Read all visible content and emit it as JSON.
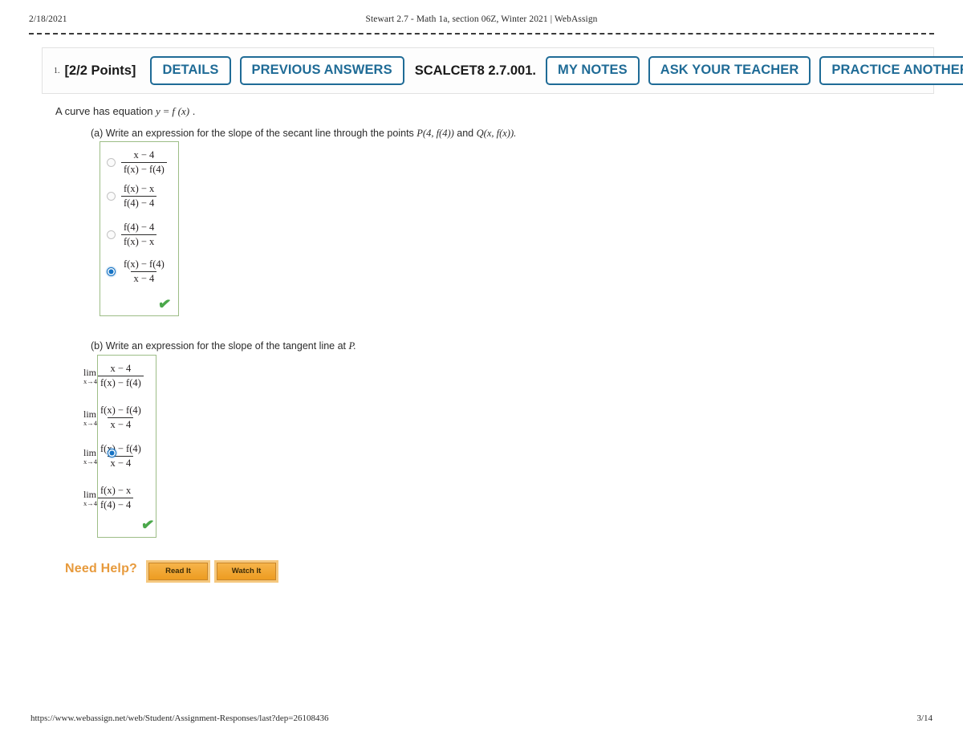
{
  "print_header": {
    "date": "2/18/2021",
    "title": "Stewart 2.7 - Math 1a, section 06Z, Winter 2021 | WebAssign"
  },
  "question_bar": {
    "number": "1.",
    "points": "[2/2 Points]",
    "details_label": "DETAILS",
    "previous_answers_label": "PREVIOUS ANSWERS",
    "code": "SCALCET8 2.7.001.",
    "my_notes_label": "MY NOTES",
    "ask_teacher_label": "ASK YOUR TEACHER",
    "practice_another_label": "PRACTICE ANOTHER",
    "button_color": "#1f6b96"
  },
  "question": {
    "stem_prefix": "A curve has equation",
    "stem_y": "y",
    "stem_eq": "=",
    "stem_f": "f",
    "stem_x": "(x)",
    "stem_period": ".",
    "part_a": {
      "label": "(a)",
      "text": "Write an expression for the slope of the secant line through the points",
      "point_p": "P(4, f(4))",
      "conj": "and",
      "point_q": "Q(x, f(x)).",
      "selected_index": 3,
      "correct": true,
      "check_glyph": "✔",
      "options": [
        {
          "numerator": "x − 4",
          "denominator": "f(x) − f(4)"
        },
        {
          "numerator": "f(x) − x",
          "denominator": "f(4) − 4"
        },
        {
          "numerator": "f(4) − 4",
          "denominator": "f(x) − x"
        },
        {
          "numerator": "f(x) − f(4)",
          "denominator": "x − 4"
        }
      ]
    },
    "part_b": {
      "label": "(b)",
      "text": "Write an expression for the slope of the tangent line at",
      "point": "P.",
      "selected_index": 2,
      "correct": true,
      "check_glyph": "✔",
      "lim_op": "lim",
      "lim_sub": "x→4",
      "options": [
        {
          "numerator": "x − 4",
          "denominator": "f(x) − f(4)"
        },
        {
          "numerator": "f(x) − f(4)",
          "denominator": "x − 4"
        },
        {
          "numerator": "f(x) − f(4)",
          "denominator": "x − 4"
        },
        {
          "numerator": "f(x) − x",
          "denominator": "f(4) − 4"
        }
      ]
    }
  },
  "need_help": {
    "label": "Need Help?",
    "read_it_label": "Read It",
    "watch_it_label": "Watch It",
    "accent_color": "#e79a3c"
  },
  "print_footer": {
    "url": "https://www.webassign.net/web/Student/Assignment-Responses/last?dep=26108436",
    "page": "3/14"
  }
}
